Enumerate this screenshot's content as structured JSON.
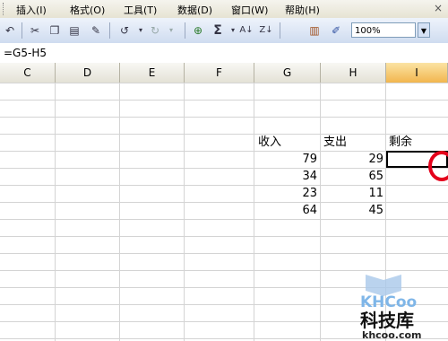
{
  "menu": {
    "items": [
      "插入(I)",
      "格式(O)",
      "工具(T)",
      "数据(D)",
      "窗口(W)",
      "帮助(H)"
    ],
    "close_glyph": "×"
  },
  "toolbar": {
    "zoom_value": "100%",
    "icons": [
      "undo-icon",
      "scissors-icon",
      "copy-icon",
      "paste-icon",
      "format-painter-icon",
      "undo-arrow-icon",
      "redo-arrow-icon",
      "hyperlink-icon",
      "autosum-icon",
      "sort-ascending-icon",
      "sort-descending-icon",
      "chart-wizard-icon",
      "drawing-icon"
    ],
    "autosum_glyph": "Σ"
  },
  "formula_bar": {
    "formula": "=G5-H5"
  },
  "columns": [
    "C",
    "D",
    "E",
    "F",
    "G",
    "H",
    "I"
  ],
  "active_column": "I",
  "sheet": {
    "headers": {
      "income": "收入",
      "expense": "支出",
      "remaining": "剩余"
    },
    "rows": [
      {
        "income": "79",
        "expense": "29"
      },
      {
        "income": "34",
        "expense": "65"
      },
      {
        "income": "23",
        "expense": "11"
      },
      {
        "income": "64",
        "expense": "45"
      }
    ]
  },
  "watermark": {
    "logo": "KHCoo",
    "name": "科技库",
    "url": "khcoo.com"
  },
  "colors": {
    "annotation_red": "#e4001b",
    "active_column": "#f2b64e"
  }
}
